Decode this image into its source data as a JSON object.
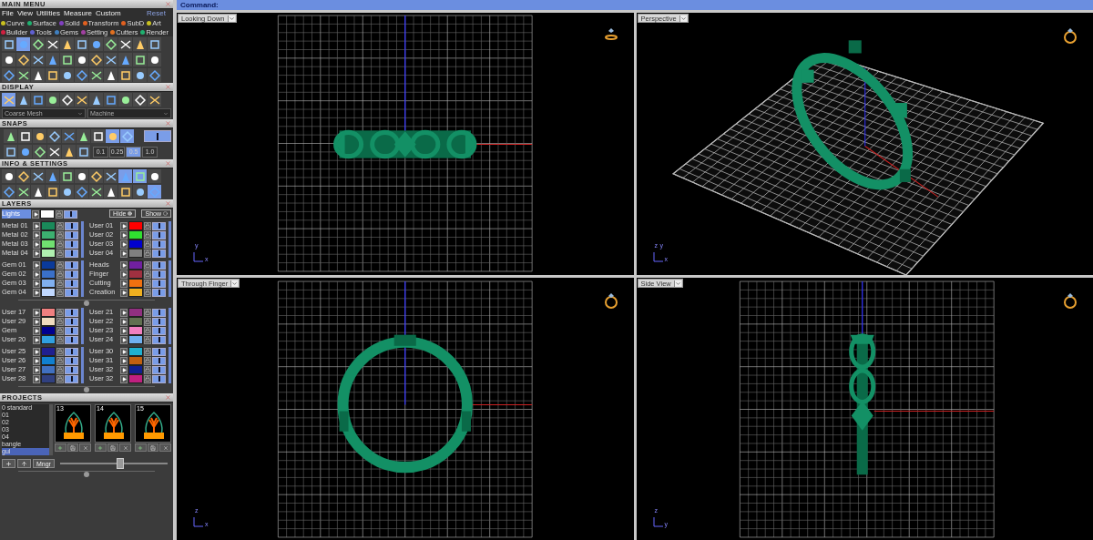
{
  "main_menu": {
    "title": "MAIN MENU",
    "menu": [
      "File",
      "View",
      "Utilities",
      "Measure",
      "Custom"
    ],
    "reset": "Reset",
    "categories": [
      {
        "label": "Curve",
        "color": "#c8c020"
      },
      {
        "label": "Surface",
        "color": "#20b070"
      },
      {
        "label": "Solid",
        "color": "#8040c0"
      },
      {
        "label": "Transform",
        "color": "#e06020"
      },
      {
        "label": "SubD",
        "color": "#e06020"
      },
      {
        "label": "Art",
        "color": "#c8c020"
      },
      {
        "label": "Builder",
        "color": "#d02040"
      },
      {
        "label": "Tools",
        "color": "#6060d0"
      },
      {
        "label": "Gems",
        "color": "#4080c0"
      },
      {
        "label": "Setting",
        "color": "#a040a0"
      },
      {
        "label": "Cutters",
        "color": "#e07020"
      },
      {
        "label": "Render",
        "color": "#20b070"
      }
    ]
  },
  "display": {
    "title": "DISPLAY",
    "mesh": "Coarse Mesh",
    "material": "Machine"
  },
  "snaps": {
    "title": "SNAPS",
    "steps": [
      {
        "label": "0.1",
        "selected": false
      },
      {
        "label": "0.25",
        "selected": false
      },
      {
        "label": "0.5",
        "selected": true
      },
      {
        "label": "1.0",
        "selected": false
      }
    ]
  },
  "info_settings": {
    "title": "INFO & SETTINGS"
  },
  "layers": {
    "title": "LAYERS",
    "lights": {
      "name": "Lights",
      "color": "#ffffff"
    },
    "hide": "Hide",
    "show": "Show",
    "blocks": [
      {
        "left": [
          {
            "name": "Metal 01",
            "color": "#1a8a5a"
          },
          {
            "name": "Metal 02",
            "color": "#3cb070"
          },
          {
            "name": "Metal 03",
            "color": "#70e070"
          },
          {
            "name": "Metal 04",
            "color": "#b0f0b0"
          }
        ],
        "right": [
          {
            "name": "User 01",
            "color": "#ff0000"
          },
          {
            "name": "User 02",
            "color": "#30e030"
          },
          {
            "name": "User 03",
            "color": "#0000d0"
          },
          {
            "name": "User 04",
            "color": "#808080"
          }
        ]
      },
      {
        "left": [
          {
            "name": "Gem 01",
            "color": "#0a3a9a"
          },
          {
            "name": "Gem 02",
            "color": "#3a70c8"
          },
          {
            "name": "Gem 03",
            "color": "#80b0f0"
          },
          {
            "name": "Gem 04",
            "color": "#c0d8ff"
          }
        ],
        "right": [
          {
            "name": "Heads",
            "color": "#7020a0"
          },
          {
            "name": "Finger",
            "color": "#a03040"
          },
          {
            "name": "Cutting",
            "color": "#f07010"
          },
          {
            "name": "Creation",
            "color": "#f0b020"
          }
        ]
      },
      {
        "left": [
          {
            "name": "User 17",
            "color": "#f08080"
          },
          {
            "name": "User 29",
            "color": "#f0dcc0"
          },
          {
            "name": "Gem",
            "color": "#000090"
          },
          {
            "name": "User 20",
            "color": "#30a0e0"
          }
        ],
        "right": [
          {
            "name": "User 21",
            "color": "#903080"
          },
          {
            "name": "User 22",
            "color": "#607050"
          },
          {
            "name": "User 23",
            "color": "#f080c0"
          },
          {
            "name": "User 24",
            "color": "#70b0f0"
          }
        ]
      },
      {
        "left": [
          {
            "name": "User 25",
            "color": "#202090"
          },
          {
            "name": "User 26",
            "color": "#1080d0"
          },
          {
            "name": "User 27",
            "color": "#4070c0"
          },
          {
            "name": "User 28",
            "color": "#304080"
          }
        ],
        "right": [
          {
            "name": "User 30",
            "color": "#20b0d0"
          },
          {
            "name": "User 31",
            "color": "#c06010"
          },
          {
            "name": "User 32",
            "color": "#102090"
          },
          {
            "name": "User 32",
            "color": "#c02080"
          }
        ]
      }
    ]
  },
  "projects": {
    "title": "PROJECTS",
    "items": [
      {
        "label": "0 standard",
        "selected": false
      },
      {
        "label": "01",
        "selected": false
      },
      {
        "label": "02",
        "selected": false
      },
      {
        "label": "03",
        "selected": false
      },
      {
        "label": "04",
        "selected": false
      },
      {
        "label": "bangle",
        "selected": false
      },
      {
        "label": "gul",
        "selected": true
      }
    ],
    "thumbnails": [
      "13",
      "14",
      "15"
    ],
    "manager": "Mngr",
    "zoom": {
      "level": 0.55
    }
  },
  "command": "Command:",
  "viewports": [
    {
      "label": "Looking Down",
      "kind": "top",
      "axes": [
        "y",
        "x"
      ]
    },
    {
      "label": "Perspective",
      "kind": "perspective",
      "axes": [
        "z",
        "y",
        "x"
      ]
    },
    {
      "label": "Through Finger",
      "kind": "front",
      "axes": [
        "z",
        "x"
      ]
    },
    {
      "label": "Side View",
      "kind": "side",
      "axes": [
        "z",
        "y"
      ]
    }
  ]
}
